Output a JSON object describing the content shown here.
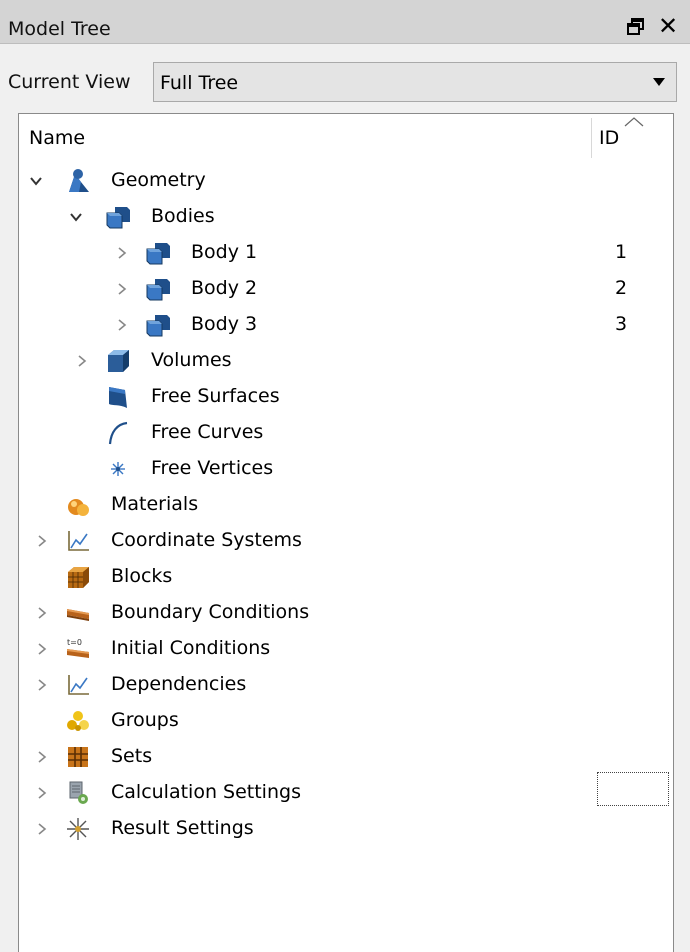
{
  "window": {
    "title": "Model Tree"
  },
  "current_view": {
    "label": "Current View",
    "selected": "Full Tree"
  },
  "columns": {
    "name": "Name",
    "id": "ID"
  },
  "tree": {
    "geometry": {
      "label": "Geometry",
      "icon": "geometry-icon",
      "state": "expanded"
    },
    "bodies": {
      "label": "Bodies",
      "icon": "bodies-icon",
      "state": "expanded"
    },
    "body1": {
      "label": "Body 1",
      "id": "1",
      "icon": "body-icon",
      "state": "collapsed"
    },
    "body2": {
      "label": "Body 2",
      "id": "2",
      "icon": "body-icon",
      "state": "collapsed"
    },
    "body3": {
      "label": "Body 3",
      "id": "3",
      "icon": "body-icon",
      "state": "collapsed"
    },
    "volumes": {
      "label": "Volumes",
      "icon": "volume-cube-icon",
      "state": "collapsed"
    },
    "free_surfaces": {
      "label": "Free Surfaces",
      "icon": "surface-icon"
    },
    "free_curves": {
      "label": "Free Curves",
      "icon": "curve-icon"
    },
    "free_vertices": {
      "label": "Free Vertices",
      "icon": "vertex-icon"
    },
    "materials": {
      "label": "Materials",
      "icon": "materials-icon"
    },
    "coordinate_systems": {
      "label": "Coordinate Systems",
      "icon": "coordinate-systems-icon",
      "state": "collapsed"
    },
    "blocks": {
      "label": "Blocks",
      "icon": "blocks-icon"
    },
    "boundary_conditions": {
      "label": "Boundary Conditions",
      "icon": "boundary-conditions-icon",
      "state": "collapsed"
    },
    "initial_conditions": {
      "label": "Initial Conditions",
      "icon": "initial-conditions-icon",
      "state": "collapsed"
    },
    "initial_conditions_icon_text": "t=0",
    "dependencies": {
      "label": "Dependencies",
      "icon": "dependencies-icon",
      "state": "collapsed"
    },
    "groups": {
      "label": "Groups",
      "icon": "groups-icon"
    },
    "sets": {
      "label": "Sets",
      "icon": "sets-icon",
      "state": "collapsed"
    },
    "calculation_settings": {
      "label": "Calculation Settings",
      "icon": "calculation-settings-icon",
      "state": "collapsed"
    },
    "result_settings": {
      "label": "Result Settings",
      "icon": "result-settings-icon",
      "state": "collapsed"
    }
  },
  "colors": {
    "titlebar": "#d4d4d4",
    "panel_bg": "#f0f0f0",
    "tree_bg": "#ffffff",
    "geometry_blue": "#1f4f8a"
  }
}
